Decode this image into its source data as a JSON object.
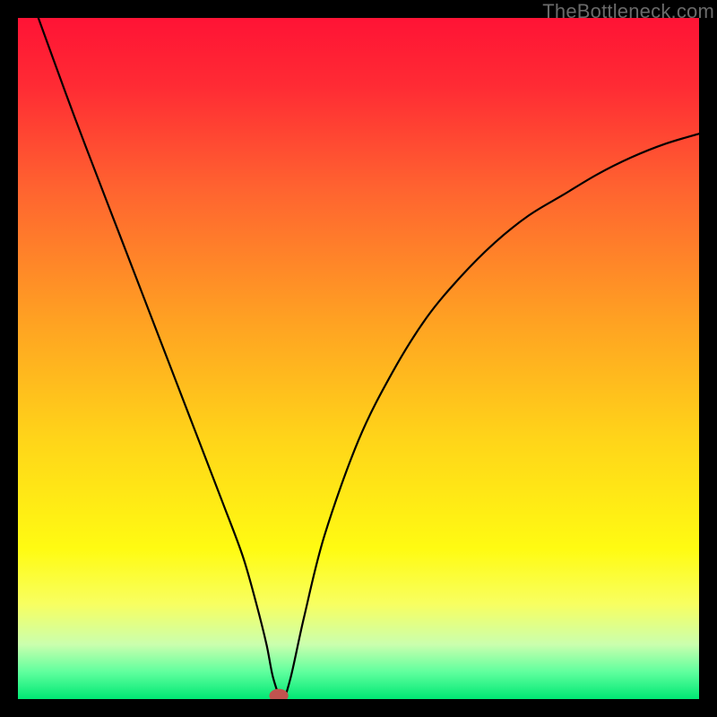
{
  "watermark": "TheBottleneck.com",
  "chart_data": {
    "type": "line",
    "title": "",
    "xlabel": "",
    "ylabel": "",
    "xlim": [
      0,
      100
    ],
    "ylim": [
      0,
      100
    ],
    "grid": false,
    "background_gradient": [
      {
        "stop": 0.0,
        "color": "#ff1335"
      },
      {
        "stop": 0.1,
        "color": "#ff2b34"
      },
      {
        "stop": 0.25,
        "color": "#ff6330"
      },
      {
        "stop": 0.45,
        "color": "#ffa322"
      },
      {
        "stop": 0.62,
        "color": "#ffd519"
      },
      {
        "stop": 0.78,
        "color": "#fffb12"
      },
      {
        "stop": 0.86,
        "color": "#f8ff60"
      },
      {
        "stop": 0.92,
        "color": "#caffae"
      },
      {
        "stop": 0.96,
        "color": "#60ff9e"
      },
      {
        "stop": 1.0,
        "color": "#00e874"
      }
    ],
    "series": [
      {
        "name": "bottleneck-curve",
        "color": "#000000",
        "x": [
          3,
          7,
          10,
          15,
          20,
          25,
          30,
          33,
          35,
          36.5,
          37.5,
          38.8,
          40,
          42,
          45,
          50,
          55,
          60,
          65,
          70,
          75,
          80,
          85,
          90,
          95,
          100
        ],
        "values": [
          100,
          89,
          81,
          68,
          55,
          42,
          29,
          21,
          14,
          8,
          3,
          0,
          3,
          12,
          24,
          38,
          48,
          56,
          62,
          67,
          71,
          74,
          77,
          79.5,
          81.5,
          83
        ]
      }
    ],
    "marker": {
      "name": "optimum-point",
      "x": 38.3,
      "y": 0.5,
      "rx": 1.4,
      "ry": 1.0,
      "color": "#c1534f"
    }
  }
}
